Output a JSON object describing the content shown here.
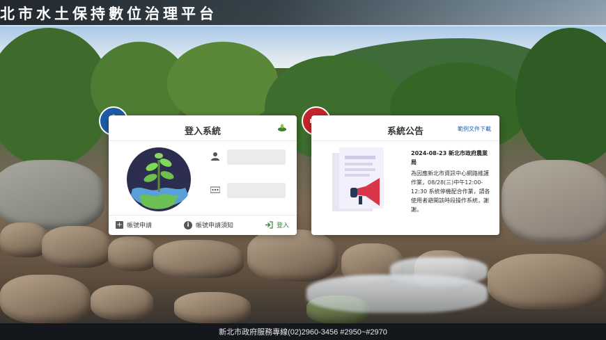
{
  "header": {
    "title": "北市水土保持數位治理平台"
  },
  "login_card": {
    "title": "登入系統",
    "username_placeholder": "",
    "password_placeholder": "",
    "footer": {
      "apply_label": "帳號申請",
      "notice_label": "帳號申請須知",
      "login_label": "登入"
    }
  },
  "announcement_card": {
    "title": "系統公告",
    "download_link": "範例文件下載",
    "date_line": "2024-08-23 新北市政府農業局",
    "body": "為因應新北市資訊中心網路維護作業，08/28(三)中午12:00-12:30 系統停機配合作業，請各使用者避開該時段操作系統，謝謝。"
  },
  "footer": {
    "text": "新北市政府服務專線(02)2960-3456 #2950~#2970"
  },
  "colors": {
    "login_badge": "#1d5ca8",
    "announce_badge": "#c4262e",
    "login_link": "#2e8b3a"
  },
  "icons": [
    "leaf-badge-icon",
    "megaphone-badge-icon",
    "user-icon",
    "password-icon",
    "plus-icon",
    "info-icon",
    "login-arrow-icon"
  ]
}
